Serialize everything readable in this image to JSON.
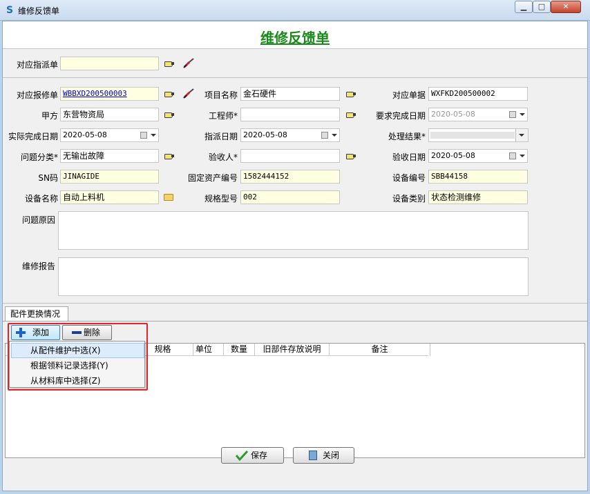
{
  "window": {
    "title": "维修反馈单",
    "app_icon": "S",
    "min_icon": "minimize-icon",
    "max_icon": "maximize-icon",
    "close_icon": "close-icon",
    "min_glyph": "▁",
    "max_glyph": "□",
    "close_glyph": "✕"
  },
  "form": {
    "heading": "维修反馈单"
  },
  "dispatch": {
    "label": "对应指派单",
    "value": ""
  },
  "fields": {
    "repair_order": {
      "label": "对应报修单",
      "value": "WBBXD200500003"
    },
    "project_name": {
      "label": "项目名称",
      "value": "金石硬件"
    },
    "doc_no": {
      "label": "对应单据",
      "value": "WXFKD200500002"
    },
    "party_a": {
      "label": "甲方",
      "value": "东营物资局"
    },
    "engineer": {
      "label": "工程师*",
      "value": ""
    },
    "req_date": {
      "label": "要求完成日期",
      "value": "2020-05-08"
    },
    "actual_date": {
      "label": "实际完成日期",
      "value": "2020-05-08"
    },
    "assign_date": {
      "label": "指派日期",
      "value": "2020-05-08"
    },
    "result": {
      "label": "处理结果*",
      "value": ""
    },
    "category": {
      "label": "问题分类*",
      "value": "无输出故障"
    },
    "checker": {
      "label": "验收人*",
      "value": ""
    },
    "check_date": {
      "label": "验收日期",
      "value": "2020-05-08"
    },
    "sn": {
      "label": "SN码",
      "value": "JINAGIDE"
    },
    "asset_no": {
      "label": "固定资产编号",
      "value": "1582444152"
    },
    "device_no": {
      "label": "设备编号",
      "value": "SBB44158"
    },
    "device_name": {
      "label": "设备名称",
      "value": "自动上料机"
    },
    "model": {
      "label": "规格型号",
      "value": "002"
    },
    "device_type": {
      "label": "设备类别",
      "value": "状态检测维修"
    },
    "cause": {
      "label": "问题原因",
      "value": ""
    },
    "report": {
      "label": "维修报告",
      "value": ""
    }
  },
  "parts_tab": {
    "tab_label": "配件更换情况",
    "add_label": "添加",
    "delete_label": "删除",
    "columns": [
      "规格",
      "单位",
      "数量",
      "旧部件存放说明",
      "备注"
    ]
  },
  "add_menu": {
    "items": [
      "从配件维护中选(X)",
      "根据领料记录选择(Y)",
      "从材料库中选择(Z)"
    ]
  },
  "footer": {
    "save_label": "保存",
    "close_label": "关闭"
  },
  "colors": {
    "heading": "#1a8a1a",
    "highlight": "#e0252a",
    "field_bg": "#ffffe1"
  }
}
